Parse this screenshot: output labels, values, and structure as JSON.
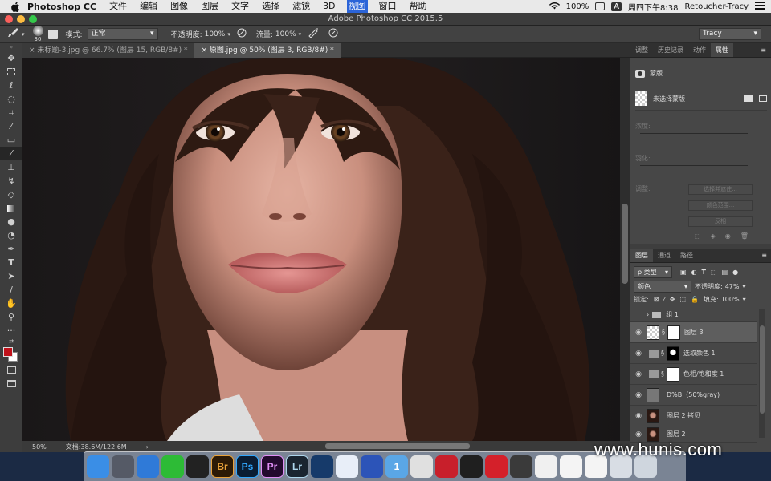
{
  "menubar": {
    "app": "Photoshop CC",
    "items": [
      "文件",
      "编辑",
      "图像",
      "图层",
      "文字",
      "选择",
      "滤镜",
      "3D",
      "视图",
      "窗口",
      "帮助"
    ],
    "active_index": 8,
    "battery": "100%",
    "input": "A",
    "datetime": "周四下午8:38",
    "user": "Retoucher-Tracy"
  },
  "window": {
    "title": "Adobe Photoshop CC 2015.5"
  },
  "options": {
    "brush_size": "30",
    "mode_label": "模式:",
    "mode_value": "正常",
    "opacity_label": "不透明度:",
    "opacity_value": "100%",
    "flow_label": "流量:",
    "flow_value": "100%",
    "workspace": "Tracy"
  },
  "tabs": [
    {
      "label": "未标题-3.jpg @ 66.7% (图层 15, RGB/8#) *"
    },
    {
      "label": "原图.jpg @ 50% (图层 3, RGB/8#) *"
    }
  ],
  "active_tab": 1,
  "status": {
    "zoom": "50%",
    "doc": "文档:38.6M/122.6M",
    "arrow": "›"
  },
  "properties": {
    "tabs": [
      "调整",
      "历史记录",
      "动作",
      "属性"
    ],
    "active_tab": 3,
    "mask_label": "蒙版",
    "no_mask": "未选择蒙版",
    "density": "浓度:",
    "feather": "羽化:",
    "refine": "调整:",
    "buttons": [
      "选择并遮住...",
      "颜色范围...",
      "反相"
    ]
  },
  "layers": {
    "tabs": [
      "图层",
      "通道",
      "路径"
    ],
    "active_tab": 0,
    "filter": "ρ 类型",
    "blend": "颜色",
    "opacity_label": "不透明度:",
    "opacity": "47%",
    "lock_label": "锁定:",
    "fill_label": "填充:",
    "fill": "100%",
    "rows": [
      {
        "name": "组 1"
      },
      {
        "name": "图层 3"
      },
      {
        "name": "选取颜色 1"
      },
      {
        "name": "色相/饱和度 1"
      },
      {
        "name": "D%B（50%gray)"
      },
      {
        "name": "图层 2 拷贝"
      },
      {
        "name": "图层 2"
      }
    ],
    "selected": 1
  },
  "dock": [
    {
      "name": "finder",
      "label": "",
      "color": "#3a8ee6"
    },
    {
      "name": "launchpad",
      "label": "",
      "color": "#555a66"
    },
    {
      "name": "safari",
      "label": "",
      "color": "#2f7ad8"
    },
    {
      "name": "wechat",
      "label": "",
      "color": "#2dbb36"
    },
    {
      "name": "qq",
      "label": "",
      "color": "#222"
    },
    {
      "name": "bridge",
      "label": "Br",
      "color": "#2c1a06"
    },
    {
      "name": "photoshop",
      "label": "Ps",
      "color": "#0a1d33"
    },
    {
      "name": "premiere",
      "label": "Pr",
      "color": "#230a2e"
    },
    {
      "name": "lightroom",
      "label": "Lr",
      "color": "#1a2430"
    },
    {
      "name": "cinema",
      "label": "",
      "color": "#163a6a"
    },
    {
      "name": "baidu",
      "label": "",
      "color": "#e8eef8"
    },
    {
      "name": "clapper",
      "label": "",
      "color": "#2c54b8"
    },
    {
      "name": "one",
      "label": "1",
      "color": "#5aa6e6"
    },
    {
      "name": "davinci",
      "label": "",
      "color": "#e0e0e0"
    },
    {
      "name": "media",
      "label": "",
      "color": "#c81f2b"
    },
    {
      "name": "obs",
      "label": "",
      "color": "#1f1f1f"
    },
    {
      "name": "netease",
      "label": "",
      "color": "#d4202a"
    },
    {
      "name": "quicktime",
      "label": "",
      "color": "#3a3a3a"
    },
    {
      "name": "textedit",
      "label": "",
      "color": "#f0f0f0"
    },
    {
      "name": "numbers",
      "label": "",
      "color": "#f4f4f4"
    },
    {
      "name": "keynote",
      "label": "",
      "color": "#f4f4f4"
    },
    {
      "name": "preview",
      "label": "",
      "color": "#d8dde4"
    },
    {
      "name": "trash",
      "label": "",
      "color": "#cfd6de"
    }
  ],
  "watermark": "www.hunis.com",
  "colors": {
    "foreground": "#c0121b",
    "background": "#ffffff"
  }
}
